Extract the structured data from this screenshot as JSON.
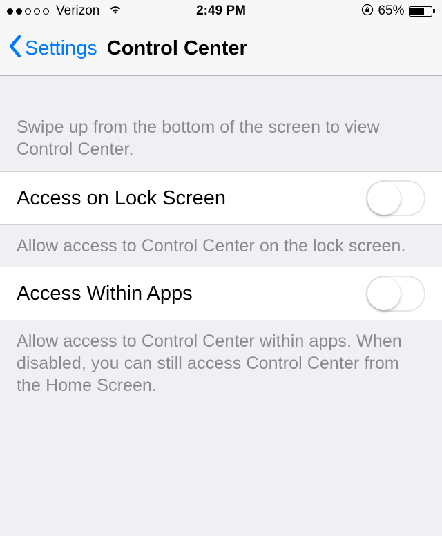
{
  "statusBar": {
    "carrier": "Verizon",
    "time": "2:49 PM",
    "batteryPct": "65%",
    "batteryFill": 65
  },
  "nav": {
    "backLabel": "Settings",
    "title": "Control Center"
  },
  "sections": {
    "introFooter": "Swipe up from the bottom of the screen to view Control Center.",
    "lockScreen": {
      "label": "Access on Lock Screen",
      "footer": "Allow access to Control Center on the lock screen."
    },
    "withinApps": {
      "label": "Access Within Apps",
      "footer": "Allow access to Control Center within apps. When disabled, you can still access Control Center from the Home Screen."
    }
  }
}
